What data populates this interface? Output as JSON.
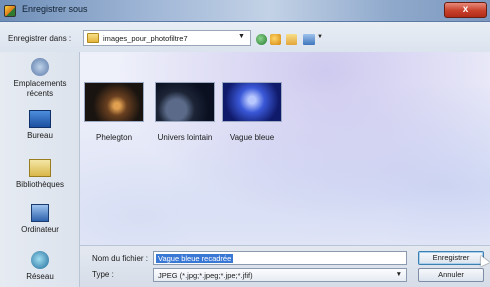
{
  "window": {
    "title": "Enregistrer sous",
    "close_label": "x"
  },
  "toolbar": {
    "save_in_label": "Enregistrer dans :",
    "current_folder": "images_pour_photofiltre7"
  },
  "places": [
    {
      "label_line1": "Emplacements",
      "label_line2": "récents",
      "icon": "recent-places-icon"
    },
    {
      "label_line1": "Bureau",
      "label_line2": "",
      "icon": "desktop-icon"
    },
    {
      "label_line1": "Bibliothèques",
      "label_line2": "",
      "icon": "libraries-icon"
    },
    {
      "label_line1": "Ordinateur",
      "label_line2": "",
      "icon": "computer-icon"
    },
    {
      "label_line1": "Réseau",
      "label_line2": "",
      "icon": "network-icon"
    }
  ],
  "files": [
    {
      "name": "Phelegton"
    },
    {
      "name": "Univers lointain"
    },
    {
      "name": "Vague bleue"
    }
  ],
  "form": {
    "filename_label": "Nom du fichier :",
    "filename_value": "Vague bleue recadrée",
    "filetype_label": "Type :",
    "filetype_value": "JPEG (*.jpg;*.jpeg;*.jpe;*.jfif)"
  },
  "buttons": {
    "save": "Enregistrer",
    "cancel": "Annuler"
  }
}
